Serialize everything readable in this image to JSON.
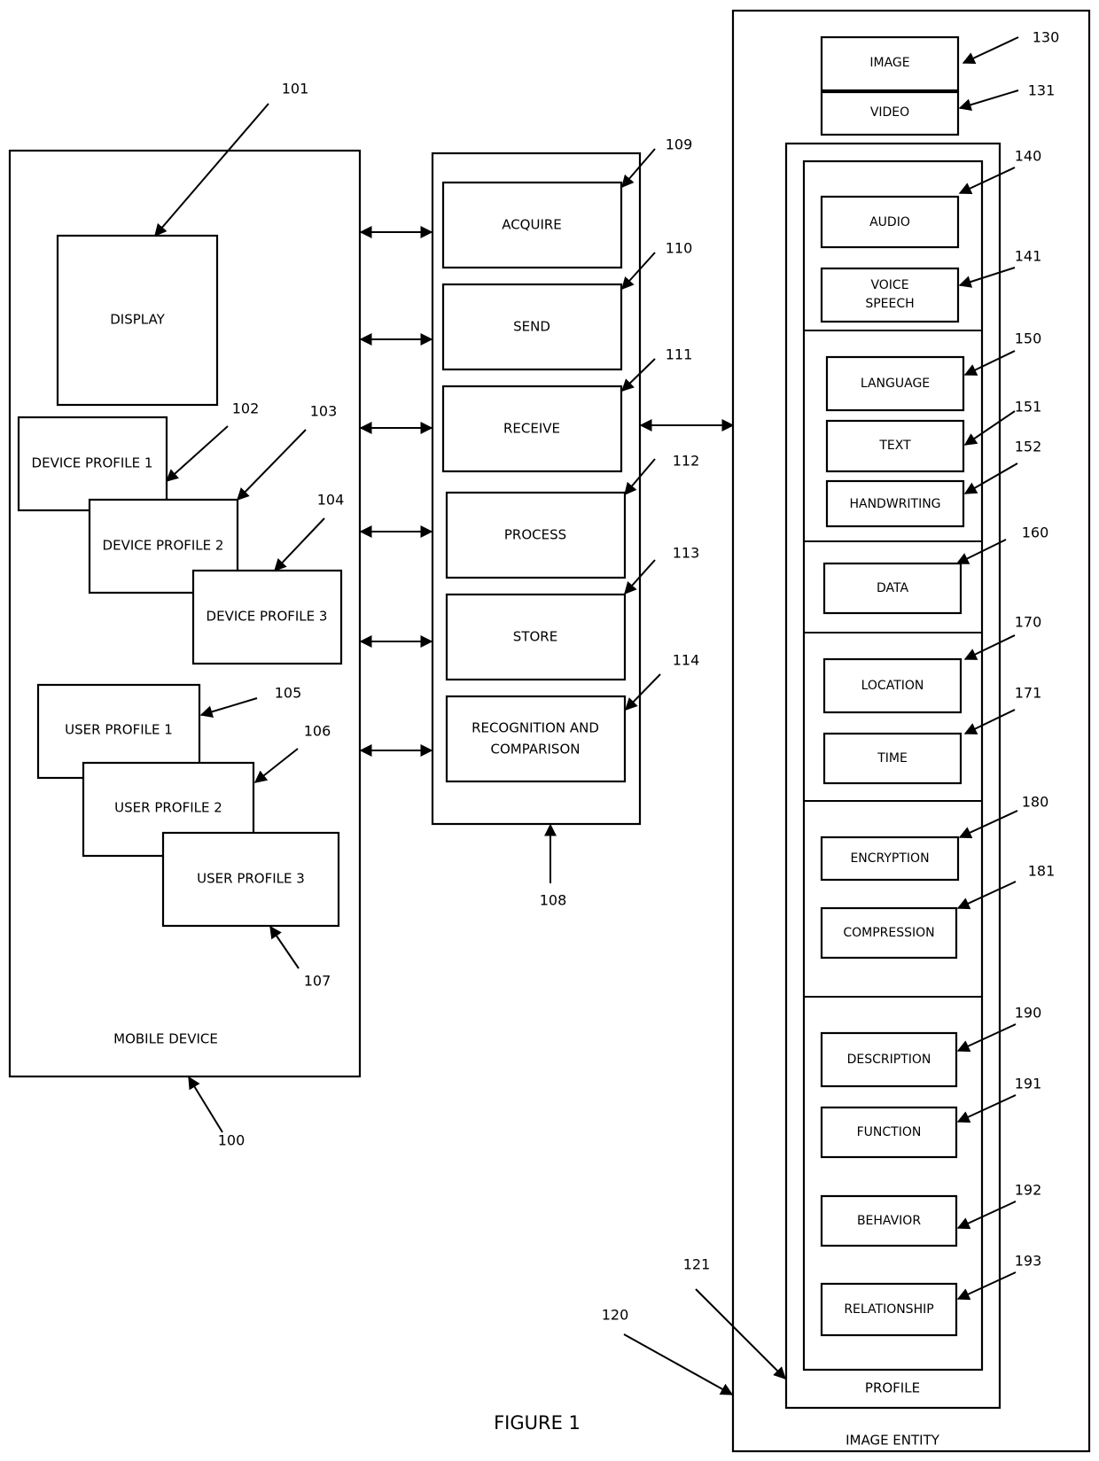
{
  "figure": {
    "caption": "FIGURE 1"
  },
  "mobile_device": {
    "label": "MOBILE DEVICE",
    "ref": "100",
    "display": {
      "label": "DISPLAY",
      "ref": "101"
    },
    "device_profiles": [
      {
        "label": "DEVICE PROFILE 1",
        "ref": "102"
      },
      {
        "label": "DEVICE PROFILE 2",
        "ref": "103"
      },
      {
        "label": "DEVICE PROFILE 3",
        "ref": "104"
      }
    ],
    "user_profiles": [
      {
        "label": "USER PROFILE 1",
        "ref": "105"
      },
      {
        "label": "USER PROFILE 2",
        "ref": "106"
      },
      {
        "label": "USER PROFILE 3",
        "ref": "107"
      }
    ]
  },
  "processor": {
    "ref": "108",
    "modules": [
      {
        "label": "ACQUIRE",
        "ref": "109"
      },
      {
        "label": "SEND",
        "ref": "110"
      },
      {
        "label": "RECEIVE",
        "ref": "111"
      },
      {
        "label": "PROCESS",
        "ref": "112"
      },
      {
        "label": "STORE",
        "ref": "113"
      },
      {
        "label_line1": "RECOGNITION AND",
        "label_line2": "COMPARISON",
        "ref": "114"
      }
    ]
  },
  "image_entity": {
    "label": "IMAGE ENTITY",
    "ref": "120",
    "image": {
      "label": "IMAGE",
      "ref": "130"
    },
    "video": {
      "label": "VIDEO",
      "ref": "131"
    },
    "profile": {
      "label": "PROFILE",
      "ref": "121",
      "audio": {
        "label": "AUDIO",
        "ref": "140"
      },
      "voice_speech": {
        "label_line1": "VOICE",
        "label_line2": "SPEECH",
        "ref": "141"
      },
      "language": {
        "label": "LANGUAGE",
        "ref": "150"
      },
      "text": {
        "label": "TEXT",
        "ref": "151"
      },
      "handwriting": {
        "label": "HANDWRITING",
        "ref": "152"
      },
      "data": {
        "label": "DATA",
        "ref": "160"
      },
      "location": {
        "label": "LOCATION",
        "ref": "170"
      },
      "time": {
        "label": "TIME",
        "ref": "171"
      },
      "encryption": {
        "label": "ENCRYPTION",
        "ref": "180"
      },
      "compression": {
        "label": "COMPRESSION",
        "ref": "181"
      },
      "description": {
        "label": "DESCRIPTION",
        "ref": "190"
      },
      "function": {
        "label": "FUNCTION",
        "ref": "191"
      },
      "behavior": {
        "label": "BEHAVIOR",
        "ref": "192"
      },
      "relationship": {
        "label": "RELATIONSHIP",
        "ref": "193"
      }
    }
  }
}
